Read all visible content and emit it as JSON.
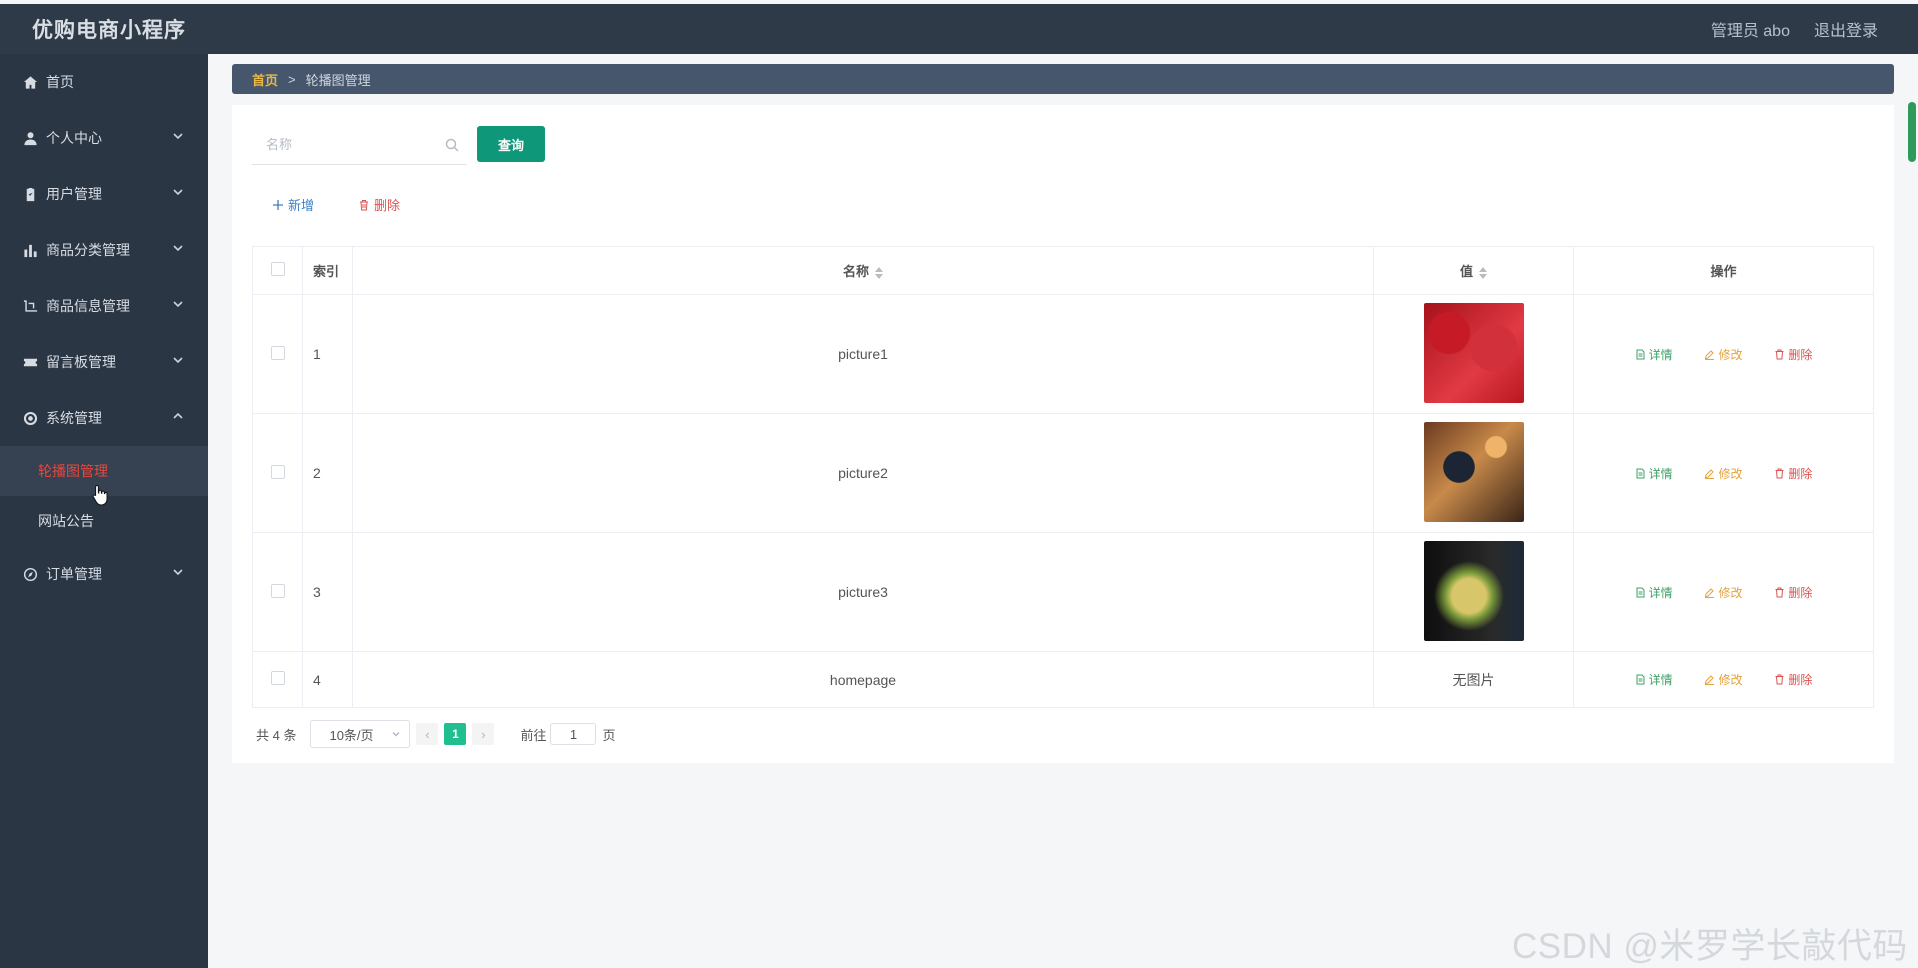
{
  "header": {
    "app_title": "优购电商小程序",
    "admin_label": "管理员 abo",
    "logout_label": "退出登录"
  },
  "sidebar": {
    "items": [
      {
        "label": "首页",
        "icon": "home-icon"
      },
      {
        "label": "个人中心",
        "icon": "user-icon"
      },
      {
        "label": "用户管理",
        "icon": "clipboard-icon"
      },
      {
        "label": "商品分类管理",
        "icon": "bar-chart-icon"
      },
      {
        "label": "商品信息管理",
        "icon": "crop-icon"
      },
      {
        "label": "留言板管理",
        "icon": "ticket-icon"
      },
      {
        "label": "系统管理",
        "icon": "settings-icon"
      },
      {
        "label": "订单管理",
        "icon": "compass-icon"
      }
    ],
    "system_sub": [
      "轮播图管理",
      "网站公告"
    ]
  },
  "breadcrumb": {
    "home": "首页",
    "separator": ">",
    "current": "轮播图管理"
  },
  "search": {
    "placeholder": "名称",
    "value": "",
    "button": "查询"
  },
  "actions": {
    "add": "新增",
    "delete": "删除"
  },
  "table": {
    "headers": {
      "index": "索引",
      "name": "名称",
      "value": "值",
      "ops": "操作"
    },
    "rows": [
      {
        "index": "1",
        "name": "picture1",
        "value": "image"
      },
      {
        "index": "2",
        "name": "picture2",
        "value": "image"
      },
      {
        "index": "3",
        "name": "picture3",
        "value": "image"
      },
      {
        "index": "4",
        "name": "homepage",
        "value": "无图片"
      }
    ],
    "ops": {
      "detail": "详情",
      "edit": "修改",
      "delete": "删除"
    }
  },
  "pagination": {
    "total": "共 4 条",
    "page_size": "10条/页",
    "current_page": "1",
    "goto_prefix": "前往",
    "goto_value": "1",
    "goto_suffix": "页"
  },
  "watermark": "CSDN @米罗学长敲代码",
  "colors": {
    "sidebar_bg": "#2b3644",
    "header_bg": "#2f3a48",
    "accent_green": "#0e9778",
    "active_red": "#e8473b"
  }
}
